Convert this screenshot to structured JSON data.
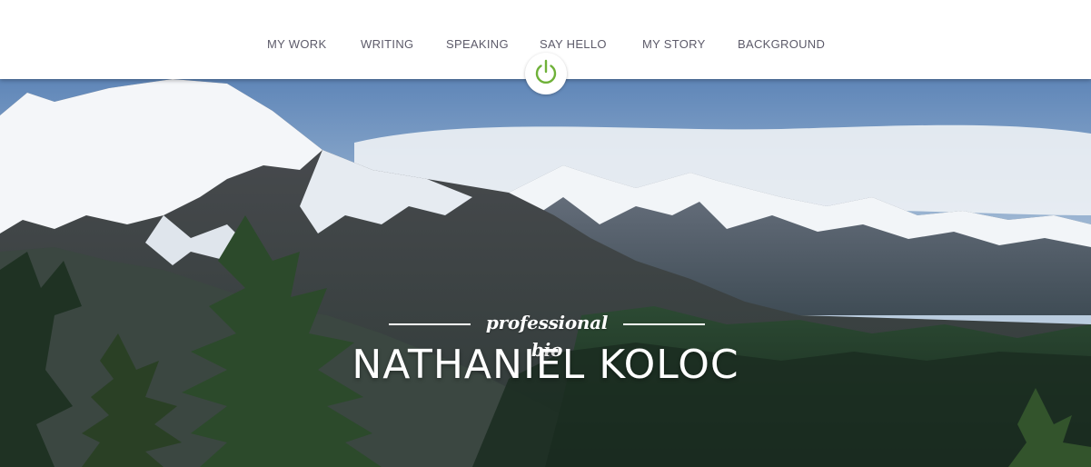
{
  "nav": {
    "items": [
      {
        "label": "MY WORK"
      },
      {
        "label": "WRITING"
      },
      {
        "label": "SPEAKING"
      },
      {
        "label": "SAY HELLO"
      },
      {
        "label": "MY STORY"
      },
      {
        "label": "BACKGROUND"
      }
    ],
    "text_color": "#5d5b6a"
  },
  "home_button": {
    "icon": "power-icon",
    "color": "#6fb139"
  },
  "hero": {
    "image": "mountain-landscape-photo",
    "subtitle": "professional bio",
    "name": "NATHANIEL KOLOC"
  }
}
